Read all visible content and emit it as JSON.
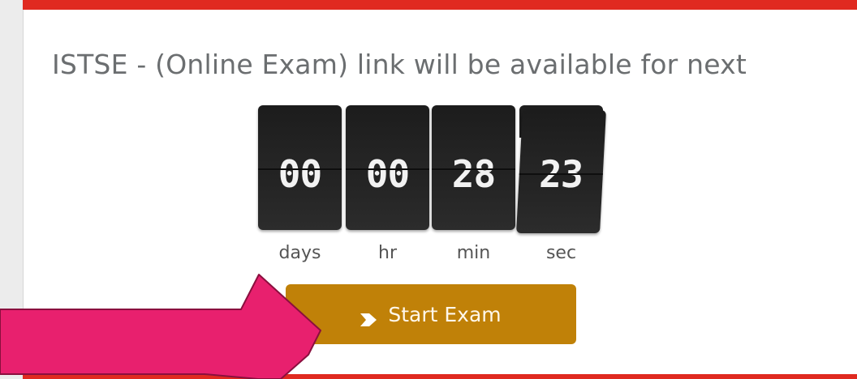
{
  "message": "ISTSE - (Online Exam) link will be available for next",
  "countdown": {
    "units": [
      {
        "value": "00",
        "label": "days"
      },
      {
        "value": "00",
        "label": "hr"
      },
      {
        "value": "28",
        "label": "min"
      },
      {
        "value": "23",
        "label": "sec"
      }
    ]
  },
  "start_button": {
    "label": "Start Exam",
    "icon": "chevron-right-icon"
  },
  "colors": {
    "accent_red": "#e02a20",
    "button": "#c08108",
    "arrow": "#e8206e"
  }
}
